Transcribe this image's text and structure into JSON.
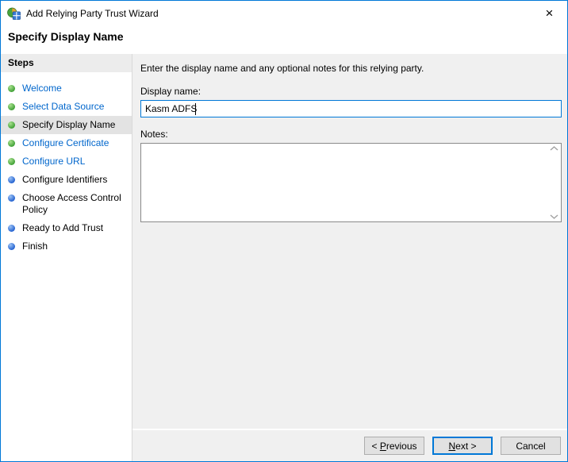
{
  "window": {
    "title": "Add Relying Party Trust Wizard",
    "close_glyph": "×"
  },
  "page": {
    "heading": "Specify Display Name"
  },
  "sidebar": {
    "heading": "Steps",
    "steps": [
      {
        "label": "Welcome",
        "bullet": "green",
        "state": "link"
      },
      {
        "label": "Select Data Source",
        "bullet": "green",
        "state": "link"
      },
      {
        "label": "Specify Display Name",
        "bullet": "green",
        "state": "current"
      },
      {
        "label": "Configure Certificate",
        "bullet": "green",
        "state": "link"
      },
      {
        "label": "Configure URL",
        "bullet": "green",
        "state": "link"
      },
      {
        "label": "Configure Identifiers",
        "bullet": "blue",
        "state": "upcoming"
      },
      {
        "label": "Choose Access Control Policy",
        "bullet": "blue",
        "state": "upcoming"
      },
      {
        "label": "Ready to Add Trust",
        "bullet": "blue",
        "state": "upcoming"
      },
      {
        "label": "Finish",
        "bullet": "blue",
        "state": "upcoming"
      }
    ]
  },
  "main": {
    "description": "Enter the display name and any optional notes for this relying party.",
    "display_name_label": "Display name:",
    "display_name_value": "Kasm ADFS",
    "notes_label": "Notes:"
  },
  "footer": {
    "previous": {
      "pre": "< ",
      "mnemonic": "P",
      "rest": "revious"
    },
    "next": {
      "pre": "",
      "mnemonic": "N",
      "rest": "ext >"
    },
    "cancel": {
      "pre": "",
      "mnemonic": "",
      "rest": "Cancel"
    }
  },
  "icons": {
    "app": "adfs-trust-wizard-icon",
    "scroll_up": "chevron-up",
    "scroll_down": "chevron-down"
  },
  "colors": {
    "accent": "#0078d7",
    "link": "#0066cc",
    "main_bg": "#f0f0f0",
    "selected_bg": "#e3e3e3",
    "bullet_green": "#3c9e33",
    "bullet_blue": "#1f5ecf"
  }
}
